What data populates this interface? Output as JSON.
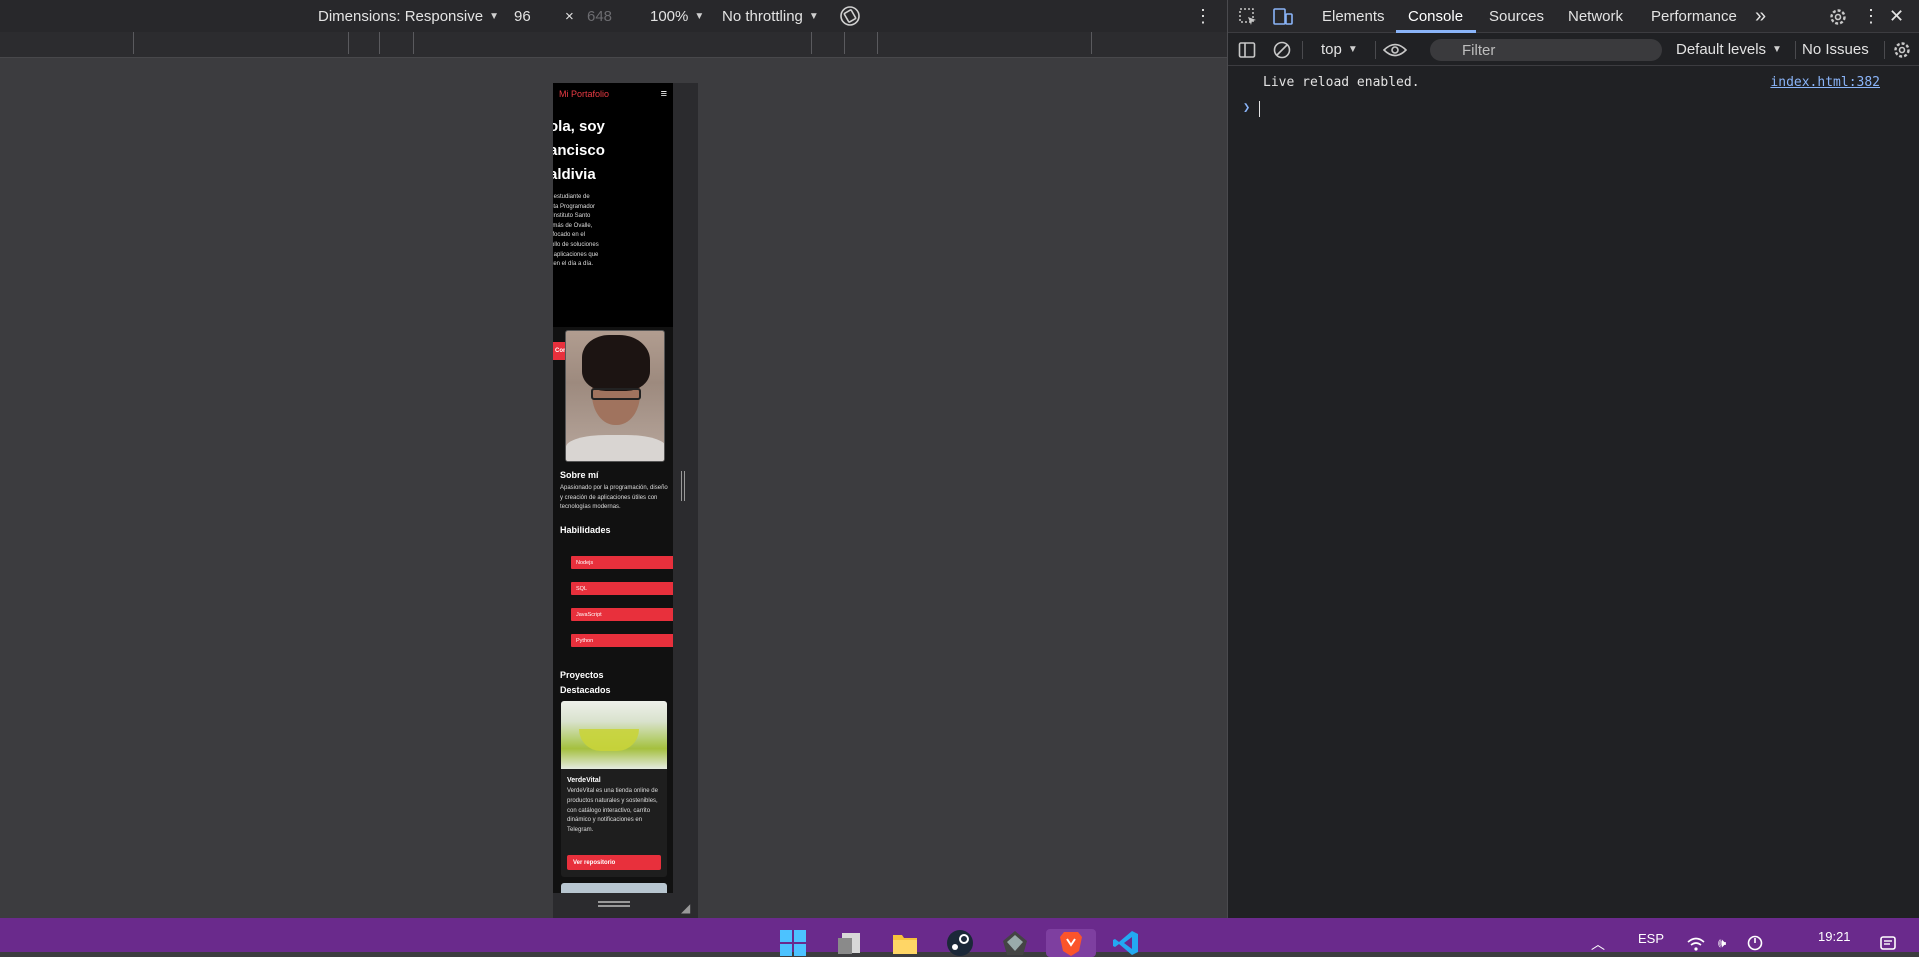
{
  "emulation_toolbar": {
    "dimensions_label": "Dimensions: Responsive",
    "width_value": "96",
    "times_symbol": "×",
    "height_placeholder": "648",
    "zoom": "100%",
    "throttling": "No throttling"
  },
  "site": {
    "brand": "Mi Portafolio",
    "menu_glyph": "≡",
    "hero_title": "ola, soy\nancisco\naldivia",
    "hero_description": "y estudiante de\nista Programador\nl Instituto Santo\nomás de Ovalle,\nnfocado en el\nrollo de soluciones\ny aplicaciones que\nliten el día a día.",
    "hero_button": "Contáctame",
    "about_title": "Sobre mí",
    "about_text": "Apasionado por la programación, diseño y creación de aplicaciones útiles con tecnologías modernas.",
    "skills_title": "Habilidades",
    "skills": [
      "Nodejs",
      "SQL",
      "JavaScript",
      "Python"
    ],
    "projects_title": "Proyectos\nDestacados",
    "project": {
      "title": "VerdeVital",
      "description": "VerdeVital es una tienda online de productos naturales y sostenibles, con catálogo interactivo, carrito dinámico y notificaciones en Telegram.",
      "button": "Ver repositorio"
    }
  },
  "devtools": {
    "tabs": [
      "Elements",
      "Console",
      "Sources",
      "Network",
      "Performance"
    ],
    "active_tab": "Console",
    "more_tabs_glyph": "»",
    "context": "top",
    "filter_placeholder": "Filter",
    "levels": "Default levels",
    "issues": "No Issues",
    "accent_color": "#8ab4f8"
  },
  "console": {
    "message": "Live reload enabled.",
    "source": "index.html:382"
  },
  "taskbar": {
    "language": "ESP",
    "time": "19:21",
    "background": "#6a2a8c"
  }
}
